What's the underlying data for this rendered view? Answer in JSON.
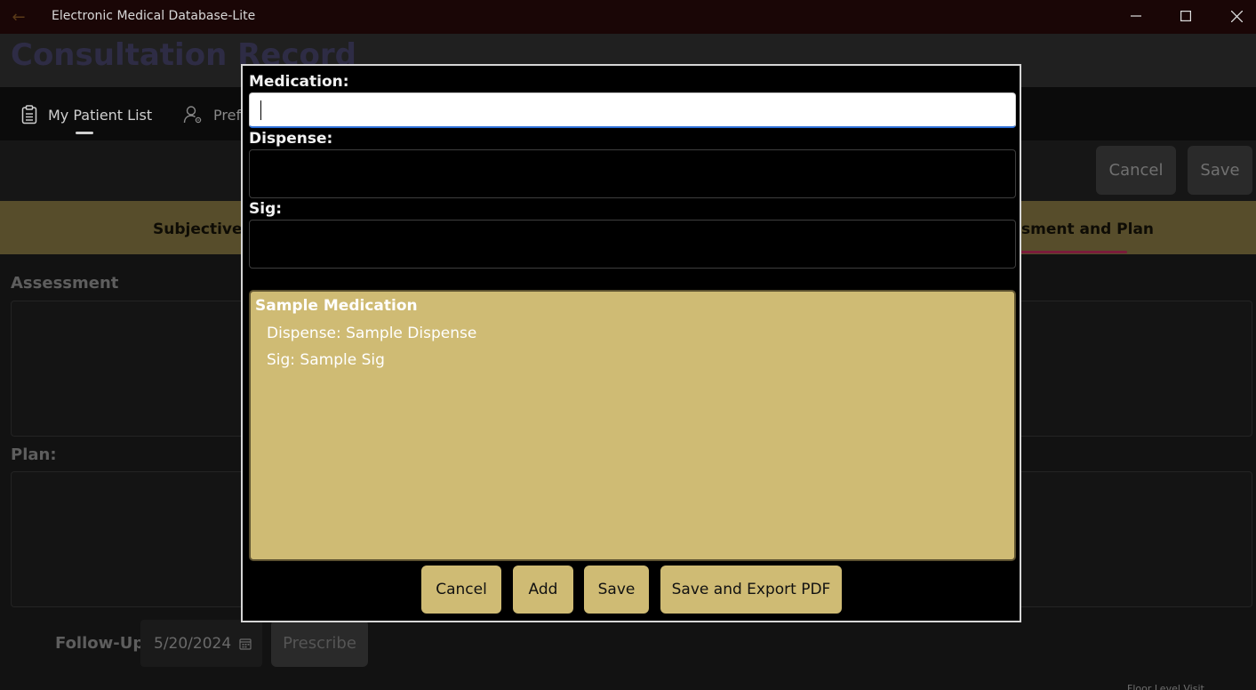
{
  "window": {
    "title": "Electronic Medical Database-Lite"
  },
  "page": {
    "title": "Consultation Record"
  },
  "nav": {
    "patient_list": "My Patient List",
    "preferences_partial": "Prefe"
  },
  "toolbar": {
    "cancel": "Cancel",
    "save": "Save"
  },
  "sections": {
    "subjective_partial": "Subjective D",
    "assessment_plan_partial": "sment and Plan"
  },
  "content": {
    "assessment_label": "Assessment",
    "plan_label": "Plan:",
    "followup_label": "Follow-Up:",
    "followup_date": "5/20/2024",
    "prescribe": "Prescribe"
  },
  "dialog": {
    "medication_label": "Medication:",
    "medication_value": "",
    "dispense_label": "Dispense:",
    "dispense_value": "",
    "sig_label": "Sig:",
    "sig_value": "",
    "items": [
      {
        "name": "Sample Medication",
        "dispense": "Dispense: Sample Dispense",
        "sig": "Sig: Sample Sig"
      }
    ],
    "buttons": {
      "cancel": "Cancel",
      "add": "Add",
      "save": "Save",
      "save_export": "Save and Export PDF"
    }
  },
  "status": {
    "partial_text": "Floor Level Visit"
  },
  "colors": {
    "accent_gold": "#cfbb74",
    "focus_blue": "#2d6fd6",
    "tab_indicator": "#7a1c3a"
  }
}
